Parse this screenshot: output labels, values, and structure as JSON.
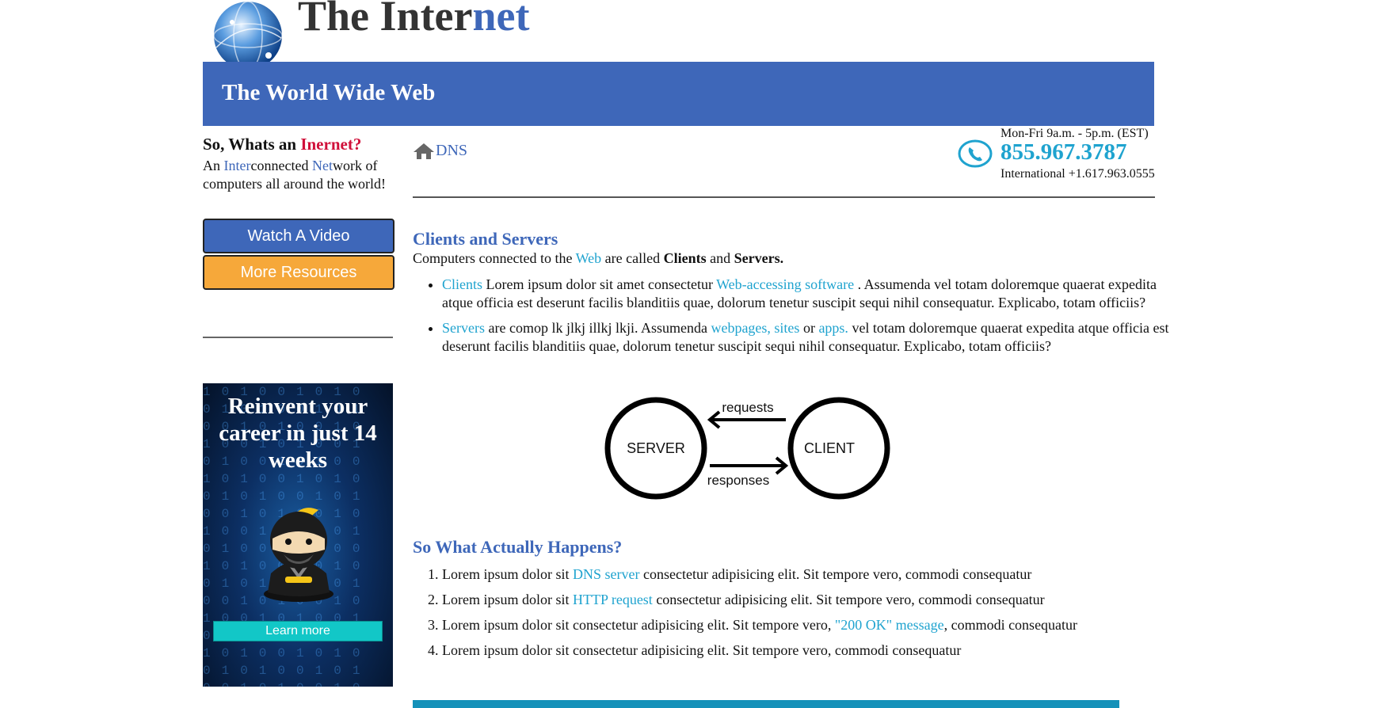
{
  "header": {
    "title_main": "The Inter",
    "title_accent": "net",
    "banner_title": "The World Wide Web"
  },
  "sidebar": {
    "question_prefix": "So, Whats an ",
    "question_highlight": "Inernet?",
    "desc": {
      "p1": "An ",
      "p2": "Inter",
      "p3": "connected ",
      "p4": "Net",
      "p5": "work of computers all around the world!"
    },
    "watch_video_label": "Watch A Video",
    "more_resources_label": "More Resources",
    "ad": {
      "title": "Reinvent your career in just 14 weeks",
      "button_label": "Learn more"
    }
  },
  "breadcrumb": {
    "label": "DNS"
  },
  "contact": {
    "hours": "Mon-Fri 9a.m. - 5p.m. (EST)",
    "phone": "855.967.3787",
    "international": "International +1.617.963.0555"
  },
  "section1": {
    "heading": "Clients and Servers",
    "intro": {
      "p1": "Computers connected to the ",
      "link": "Web",
      "p2": " are called ",
      "b1": "Clients",
      "p3": " and ",
      "b2": "Servers."
    },
    "bullets": [
      {
        "link1": "Clients",
        "t1": " Lorem ipsum dolor sit amet consectetur ",
        "link2": "Web-accessing software",
        "t2": " . Assumenda vel totam doloremque quaerat expedita atque officia est deserunt facilis blanditiis quae, dolorum tenetur suscipit sequi nihil consequatur. Explicabo, totam officiis?"
      },
      {
        "link1": "Servers",
        "t1": " are comop lk jlkj illkj lkji. Assumenda ",
        "link2": "webpages, sites",
        "t2": " or ",
        "link3": "apps.",
        "t3": " vel totam doloremque quaerat expedita atque officia est deserunt facilis blanditiis quae, dolorum tenetur suscipit sequi nihil consequatur. Explicabo, totam officiis?"
      }
    ],
    "diagram": {
      "server": "SERVER",
      "client": "CLIENT",
      "requests": "requests",
      "responses": "responses"
    }
  },
  "section2": {
    "heading": "So What Actually Happens?",
    "steps": [
      {
        "t1": "Lorem ipsum dolor sit ",
        "link": "DNS server",
        "t2": " consectetur adipisicing elit. Sit tempore vero, commodi consequatur"
      },
      {
        "t1": "Lorem ipsum dolor sit ",
        "link": "HTTP request",
        "t2": " consectetur adipisicing elit. Sit tempore vero, commodi consequatur"
      },
      {
        "t1": "Lorem ipsum dolor sit consectetur adipisicing elit. Sit tempore vero, ",
        "link": "\"200 OK\" message",
        "t2": ", commodi consequatur"
      },
      {
        "t1": "Lorem ipsum dolor sit consectetur adipisicing elit. Sit tempore vero, commodi consequatur"
      }
    ]
  },
  "colors": {
    "brand_blue": "#3e67b9",
    "link_cyan": "#1fa3cf",
    "accent_red": "#d0103a",
    "orange_button": "#f6a83a",
    "ad_button_teal": "#12c7c7",
    "bottom_bar": "#1591b9"
  },
  "icons": {
    "logo": "globe-icon",
    "breadcrumb": "home-icon",
    "contact": "phone-icon",
    "ad_mascot": "ninja-icon"
  }
}
